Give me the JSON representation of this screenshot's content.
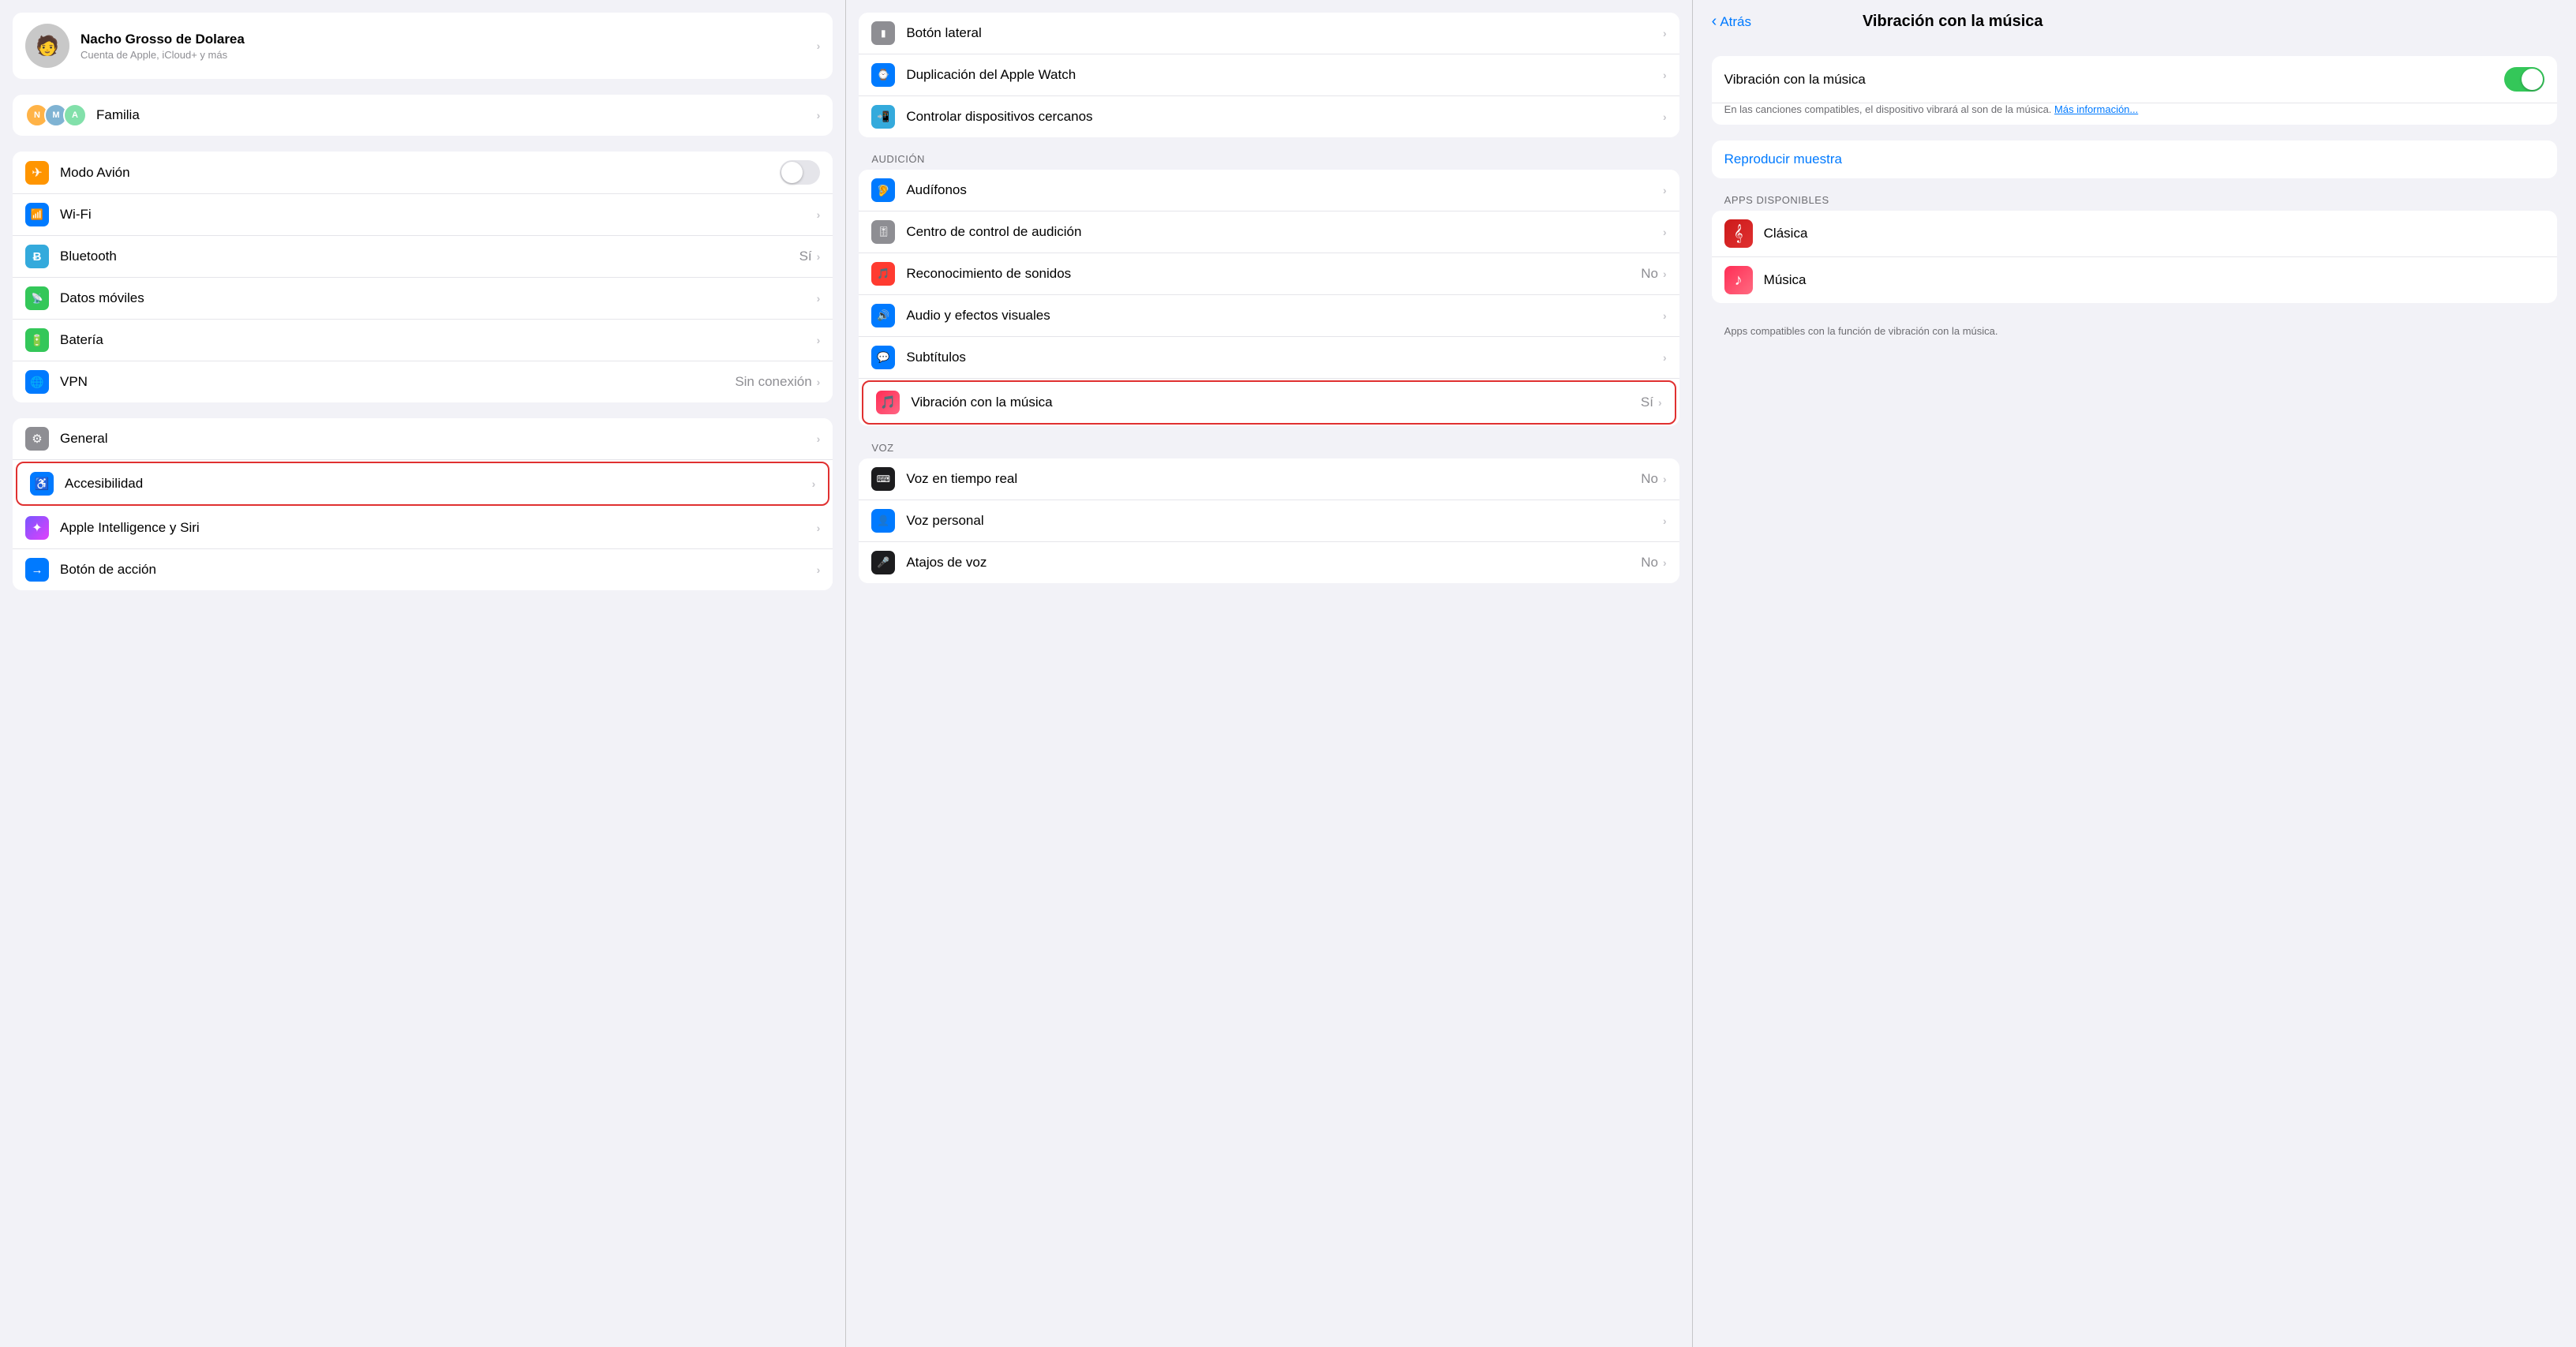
{
  "columns": {
    "col1": {
      "profile": {
        "name": "Nacho Grosso de Dolarea",
        "subtitle": "Cuenta de Apple, iCloud+ y más",
        "avatarEmoji": "🧑"
      },
      "familia": {
        "label": "Familia"
      },
      "group1": [
        {
          "id": "modo-avion",
          "icon": "✈",
          "bg": "bg-orange",
          "label": "Modo Avión",
          "value": "",
          "toggle": true,
          "toggleOn": false
        },
        {
          "id": "wifi",
          "icon": "📶",
          "bg": "bg-blue",
          "label": "Wi-Fi",
          "value": "",
          "hasChevron": true
        },
        {
          "id": "bluetooth",
          "icon": "⬡",
          "bg": "bg-blue-light",
          "label": "Bluetooth",
          "value": "Sí",
          "hasChevron": true
        },
        {
          "id": "datos-moviles",
          "icon": "📡",
          "bg": "bg-green",
          "label": "Datos móviles",
          "value": "",
          "hasChevron": true
        },
        {
          "id": "bateria",
          "icon": "🔋",
          "bg": "bg-green",
          "label": "Batería",
          "value": "",
          "hasChevron": true
        },
        {
          "id": "vpn",
          "icon": "🌐",
          "bg": "bg-blue",
          "label": "VPN",
          "value": "Sin conexión",
          "hasChevron": true
        }
      ],
      "group2": [
        {
          "id": "general",
          "icon": "⚙",
          "bg": "bg-gray",
          "label": "General",
          "value": "",
          "hasChevron": true
        },
        {
          "id": "accesibilidad",
          "icon": "♿",
          "bg": "bg-blue",
          "label": "Accesibilidad",
          "value": "",
          "hasChevron": true,
          "highlighted": true
        },
        {
          "id": "apple-intelligence",
          "icon": "✦",
          "bg": "bg-indigo",
          "label": "Apple Intelligence y Siri",
          "value": "",
          "hasChevron": true
        },
        {
          "id": "boton-accion",
          "icon": "→",
          "bg": "bg-blue",
          "label": "Botón de acción",
          "value": "",
          "hasChevron": true
        }
      ]
    },
    "col2": {
      "topItems": [
        {
          "id": "boton-lateral",
          "icon": "⬛",
          "bg": "bg-gray",
          "label": "Botón lateral",
          "value": "",
          "hasChevron": true
        },
        {
          "id": "duplicacion-watch",
          "icon": "⌚",
          "bg": "bg-blue",
          "label": "Duplicación del Apple Watch",
          "value": "",
          "hasChevron": true
        },
        {
          "id": "controlar-dispositivos",
          "icon": "📲",
          "bg": "bg-blue-light",
          "label": "Controlar dispositivos cercanos",
          "value": "",
          "hasChevron": true
        }
      ],
      "audicionHeader": "AUDICIÓN",
      "audicionItems": [
        {
          "id": "audifonos",
          "icon": "🦻",
          "bg": "bg-blue",
          "label": "Audífonos",
          "value": "",
          "hasChevron": true
        },
        {
          "id": "centro-control-audicion",
          "icon": "🎚",
          "bg": "bg-gray",
          "label": "Centro de control de audición",
          "value": "",
          "hasChevron": true
        },
        {
          "id": "reconocimiento-sonidos",
          "icon": "🎵",
          "bg": "bg-red",
          "label": "Reconocimiento de sonidos",
          "value": "No",
          "hasChevron": true
        },
        {
          "id": "audio-efectos",
          "icon": "🔊",
          "bg": "bg-blue",
          "label": "Audio y efectos visuales",
          "value": "",
          "hasChevron": true
        },
        {
          "id": "subtitulos",
          "icon": "💬",
          "bg": "bg-blue",
          "label": "Subtítulos",
          "value": "",
          "hasChevron": true
        },
        {
          "id": "vibracion-musica",
          "icon": "🎵",
          "bg": "bg-pink",
          "label": "Vibración con la música",
          "value": "Sí",
          "hasChevron": true,
          "highlighted": true
        }
      ],
      "vozHeader": "VOZ",
      "vozItems": [
        {
          "id": "voz-tiempo-real",
          "icon": "⌨",
          "bg": "bg-dark",
          "label": "Voz en tiempo real",
          "value": "No",
          "hasChevron": true
        },
        {
          "id": "voz-personal",
          "icon": "👤",
          "bg": "bg-blue",
          "label": "Voz personal",
          "value": "",
          "hasChevron": true
        },
        {
          "id": "atajos-voz",
          "icon": "🎤",
          "bg": "bg-dark",
          "label": "Atajos de voz",
          "value": "No",
          "hasChevron": true
        }
      ]
    },
    "col3": {
      "backLabel": "Atrás",
      "title": "Vibración con la música",
      "toggleLabel": "Vibración con la música",
      "toggleOn": true,
      "description": "En las canciones compatibles, el dispositivo vibrará al son de la música.",
      "masInfoLabel": "Más información...",
      "reproducirLabel": "Reproducir muestra",
      "appsHeader": "APPS DISPONIBLES",
      "apps": [
        {
          "id": "clasica",
          "icon": "𝄞",
          "bg": "bg-red",
          "name": "Clásica"
        },
        {
          "id": "musica",
          "icon": "♪",
          "bg": "bg-pink",
          "name": "Música"
        }
      ],
      "appsFooter": "Apps compatibles con la función de vibración con la música."
    }
  }
}
